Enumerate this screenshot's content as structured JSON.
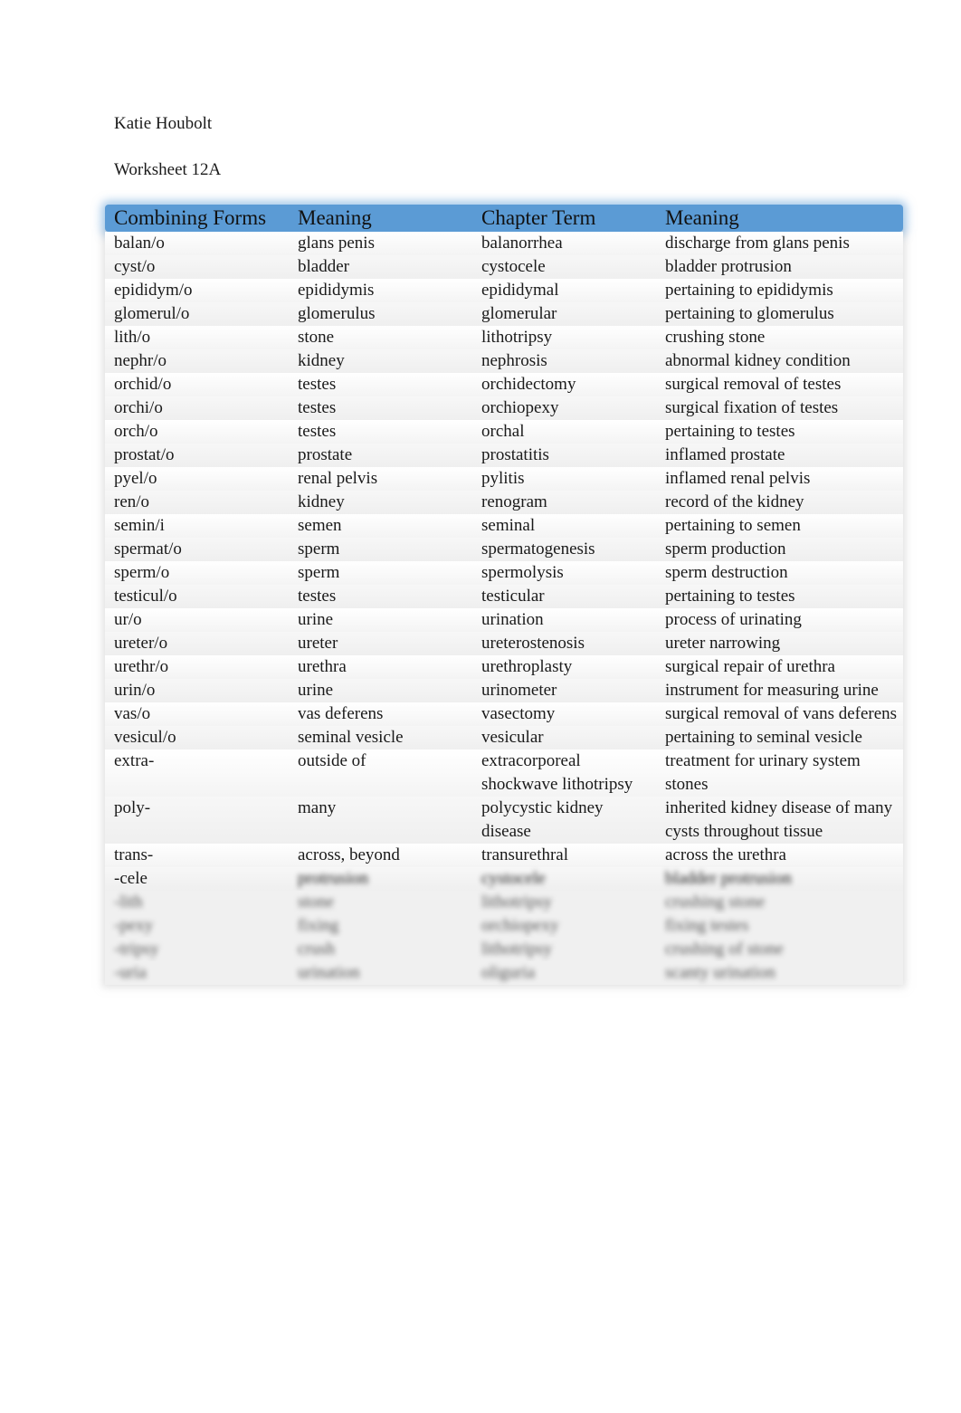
{
  "author": "Katie Houbolt",
  "title": "Worksheet 12A",
  "table": {
    "headers": [
      "Combining Forms",
      "Meaning",
      "Chapter Term",
      "Meaning"
    ],
    "rows": [
      [
        "balan/o",
        "glans penis",
        "balanorrhea",
        "discharge from glans penis"
      ],
      [
        "cyst/o",
        "bladder",
        "cystocele",
        "bladder protrusion"
      ],
      [
        "epididym/o",
        "epididymis",
        "epididymal",
        "pertaining to epididymis"
      ],
      [
        "glomerul/o",
        "glomerulus",
        "glomerular",
        "pertaining to glomerulus"
      ],
      [
        "lith/o",
        "stone",
        "lithotripsy",
        "crushing stone"
      ],
      [
        "nephr/o",
        "kidney",
        "nephrosis",
        "abnormal kidney condition"
      ],
      [
        "orchid/o",
        "testes",
        "orchidectomy",
        "surgical removal of testes"
      ],
      [
        "orchi/o",
        "testes",
        "orchiopexy",
        "surgical fixation of testes"
      ],
      [
        "orch/o",
        "testes",
        "orchal",
        "pertaining to testes"
      ],
      [
        "prostat/o",
        "prostate",
        "prostatitis",
        "inflamed prostate"
      ],
      [
        "pyel/o",
        "renal pelvis",
        "pylitis",
        "inflamed renal pelvis"
      ],
      [
        "ren/o",
        "kidney",
        "renogram",
        "record of the kidney"
      ],
      [
        "semin/i",
        "semen",
        "seminal",
        "pertaining to semen"
      ],
      [
        "spermat/o",
        "sperm",
        "spermatogenesis",
        "sperm production"
      ],
      [
        "sperm/o",
        "sperm",
        "spermolysis",
        "sperm destruction"
      ],
      [
        "testicul/o",
        "testes",
        "testicular",
        "pertaining to testes"
      ],
      [
        "ur/o",
        "urine",
        "urination",
        "process of urinating"
      ],
      [
        "ureter/o",
        "ureter",
        "ureterostenosis",
        "ureter narrowing"
      ],
      [
        "urethr/o",
        "urethra",
        "urethroplasty",
        "surgical repair of urethra"
      ],
      [
        "urin/o",
        "urine",
        "urinometer",
        "instrument for measuring urine"
      ],
      [
        "vas/o",
        "vas deferens",
        "vasectomy",
        "surgical removal of vans deferens"
      ],
      [
        "vesicul/o",
        "seminal vesicle",
        "vesicular",
        "pertaining to seminal vesicle"
      ],
      [
        "extra-",
        "outside of",
        "extracorporeal shockwave lithotripsy",
        "treatment for urinary system stones"
      ],
      [
        "poly-",
        "many",
        "polycystic kidney disease",
        "inherited kidney disease of many cysts throughout tissue"
      ],
      [
        "trans-",
        "across, beyond",
        "transurethral",
        "across the urethra"
      ]
    ],
    "partially_obscured_rows": [
      [
        "-cele",
        "protrusion",
        "cystocele",
        "bladder protrusion"
      ],
      [
        "-lith",
        "stone",
        "lithotripsy",
        "crushing stone"
      ],
      [
        "-pexy",
        "fixing",
        "orchiopexy",
        "fixing testes"
      ],
      [
        "-tripsy",
        "crush",
        "lithotripsy",
        "crushing of stone"
      ],
      [
        "-uria",
        "urination",
        "oliguria",
        "scanty urination"
      ]
    ]
  }
}
